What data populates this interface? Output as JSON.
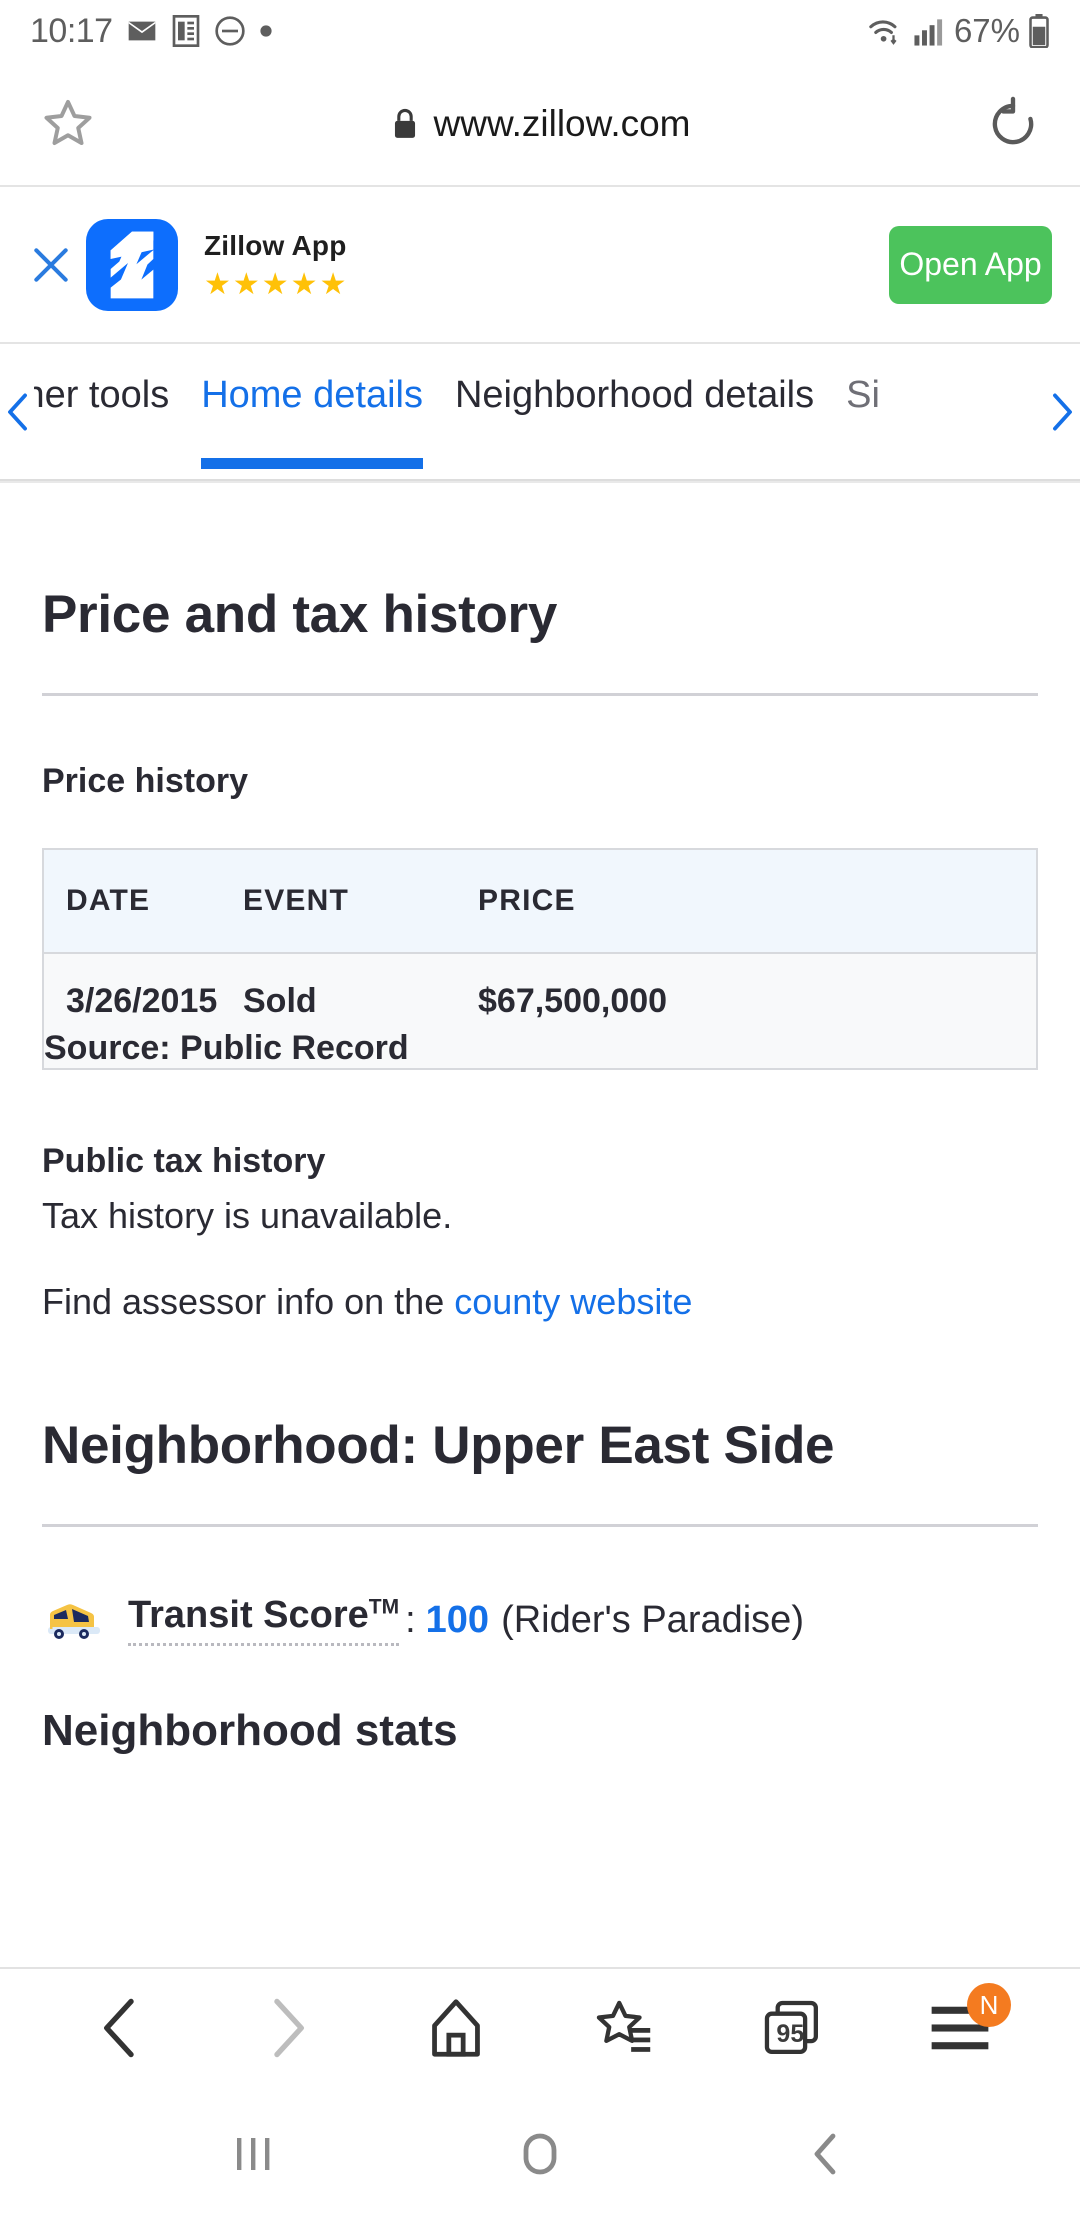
{
  "status_bar": {
    "time": "10:17",
    "icons_left": [
      "mail-icon",
      "document-icon",
      "do-not-disturb-icon",
      "dot-icon"
    ],
    "wifi": "wifi-icon",
    "signal": "signal-icon",
    "battery_percent": "67%"
  },
  "browser": {
    "bookmark_icon": "star-icon",
    "lock_icon": "lock-icon",
    "url": "www.zillow.com",
    "reload_icon": "reload-icon"
  },
  "app_banner": {
    "close_label": "✕",
    "logo_letter": "Z",
    "app_name": "Zillow App",
    "rating_stars": "★★★★★",
    "rating_value": 5,
    "open_button": "Open App",
    "button_color": "#4cc35c"
  },
  "tab_strip": {
    "prev_arrow": "chevron-left-icon",
    "next_arrow": "chevron-right-icon",
    "tabs": [
      {
        "label": "wner tools",
        "active": false
      },
      {
        "label": "Home details",
        "active": true
      },
      {
        "label": "Neighborhood details",
        "active": false
      },
      {
        "label": "Si",
        "active": false
      }
    ],
    "active_color": "#1470e8"
  },
  "content": {
    "section_title": "Price and tax history",
    "price_history_title": "Price history",
    "price_table": {
      "headers": [
        "DATE",
        "EVENT",
        "PRICE"
      ],
      "rows": [
        {
          "date": "3/26/2015",
          "event": "Sold",
          "price": "$67,500,000",
          "source": "Source: Public Record"
        }
      ]
    },
    "public_tax_title": "Public tax history",
    "tax_unavailable": "Tax history is unavailable.",
    "assessor_prefix": "Find assessor info on the ",
    "assessor_link": "county website",
    "neighborhood_title": "Neighborhood: Upper East Side",
    "transit": {
      "icon": "bus-icon",
      "label": "Transit Score",
      "trademark": "TM",
      "separator": ":",
      "score": "100",
      "description": "(Rider's Paradise)",
      "score_color": "#1470e8"
    },
    "stats_title": "Neighborhood stats"
  },
  "browser_toolbar": {
    "back": "chevron-left-icon",
    "forward": "chevron-right-icon",
    "home": "home-icon",
    "bookmarks": "star-list-icon",
    "tabs_count": "95",
    "menu": "hamburger-menu-icon",
    "menu_badge": "N",
    "badge_color": "#f47b20"
  },
  "nav_bar": {
    "recents": "recents-icon",
    "home": "home-circle-icon",
    "back": "back-chevron-icon"
  }
}
